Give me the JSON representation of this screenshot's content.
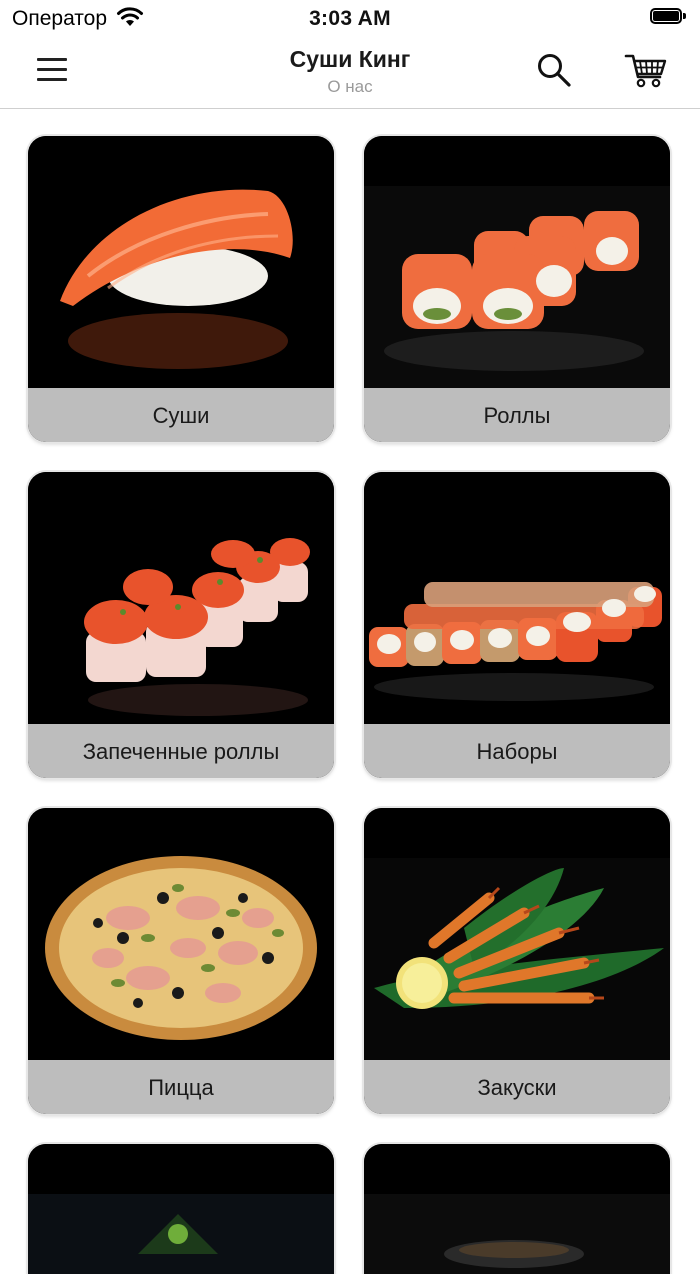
{
  "status_bar": {
    "carrier": "Оператор",
    "time": "3:03 AM",
    "icons": [
      "wifi-icon",
      "battery-icon"
    ]
  },
  "navbar": {
    "title": "Суши Кинг",
    "subtitle": "О нас",
    "icons": [
      "menu-icon",
      "search-icon",
      "cart-icon"
    ]
  },
  "categories": [
    {
      "label": "Суши"
    },
    {
      "label": "Роллы"
    },
    {
      "label": "Запеченные роллы"
    },
    {
      "label": "Наборы"
    },
    {
      "label": "Пицца"
    },
    {
      "label": "Закуски"
    }
  ],
  "colors": {
    "card_label_bg": "#bdbdbd",
    "photo_bg": "#000000",
    "salmon": "#f06a3a",
    "divider": "#cfcfcf"
  }
}
